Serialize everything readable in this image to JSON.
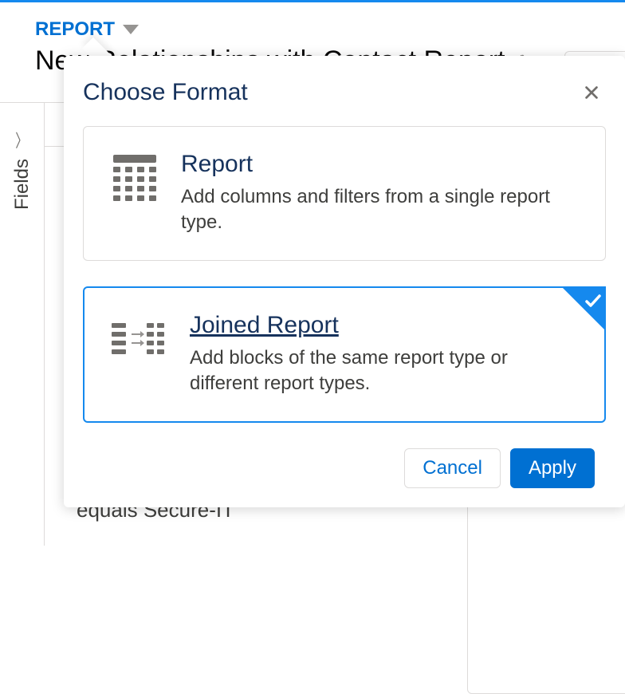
{
  "header": {
    "type_label": "REPORT",
    "title": "New Relationships with Contact Report"
  },
  "sidebar": {
    "label": "Fields"
  },
  "canvas": {
    "filter_text": "equals Secure-IT"
  },
  "modal": {
    "title": "Choose Format",
    "options": [
      {
        "title": "Report",
        "description": "Add columns and filters from a single report type.",
        "selected": false,
        "icon": "table-icon"
      },
      {
        "title": "Joined Report",
        "description": "Add blocks of the same report type or different report types.",
        "selected": true,
        "icon": "joined-icon"
      }
    ],
    "cancel_label": "Cancel",
    "apply_label": "Apply"
  }
}
